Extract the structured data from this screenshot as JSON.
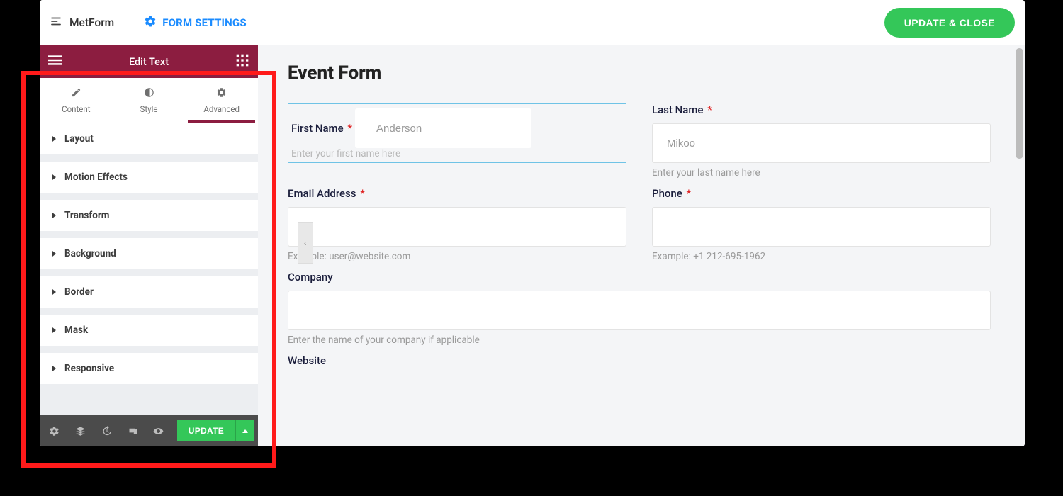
{
  "topbar": {
    "brand": "MetForm",
    "form_settings": "FORM SETTINGS",
    "update_close": "UPDATE & CLOSE"
  },
  "editor": {
    "header_title": "Edit Text",
    "tabs": {
      "content": "Content",
      "style": "Style",
      "advanced": "Advanced"
    },
    "panels": [
      "Layout",
      "Motion Effects",
      "Transform",
      "Background",
      "Border",
      "Mask",
      "Responsive"
    ],
    "footer": {
      "update": "UPDATE"
    }
  },
  "form": {
    "title": "Event Form",
    "fields": {
      "first_name": {
        "label": "First Name",
        "required": true,
        "placeholder": "Anderson",
        "help": "Enter your first name here"
      },
      "last_name": {
        "label": "Last Name",
        "required": true,
        "placeholder": "Mikoo",
        "help": "Enter your last name here"
      },
      "email": {
        "label": "Email Address",
        "required": true,
        "help": "Example: user@website.com"
      },
      "phone": {
        "label": "Phone",
        "required": true,
        "help": "Example: +1 212-695-1962"
      },
      "company": {
        "label": "Company",
        "help": "Enter the name of your company if applicable"
      },
      "website": {
        "label": "Website"
      }
    }
  }
}
